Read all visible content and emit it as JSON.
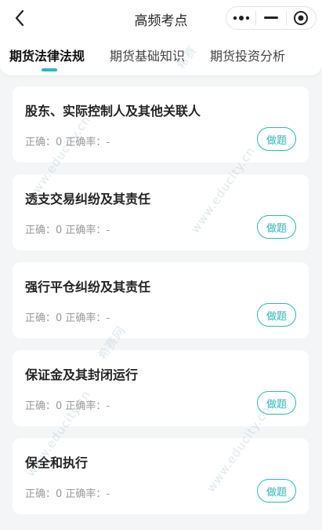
{
  "header": {
    "title": "高频考点",
    "back_icon": "chevron-left-icon",
    "capsule": {
      "more_icon": "more-dots-icon",
      "minimize_icon": "minimize-icon",
      "close_icon": "target-close-icon"
    }
  },
  "tabs": [
    {
      "label": "期货法律法规",
      "active": true
    },
    {
      "label": "期货基础知识",
      "active": false
    },
    {
      "label": "期货投资分析",
      "active": false
    }
  ],
  "accent_color": "#2fb6b6",
  "cards": [
    {
      "title": "股东、实际控制人及其他关联人",
      "stats": "正确：0 正确率：-",
      "button": "做题"
    },
    {
      "title": "透支交易纠纷及其责任",
      "stats": "正确：0 正确率：-",
      "button": "做题"
    },
    {
      "title": "强行平仓纠纷及其责任",
      "stats": "正确：0 正确率：-",
      "button": "做题"
    },
    {
      "title": "保证金及其封闭运行",
      "stats": "正确：0 正确率：-",
      "button": "做题"
    },
    {
      "title": "保全和执行",
      "stats": "正确：0 正确率：-",
      "button": "做题"
    }
  ],
  "watermark": {
    "brand": "希赛",
    "site": "www.educity.cn",
    "site_cn": "希赛网"
  }
}
